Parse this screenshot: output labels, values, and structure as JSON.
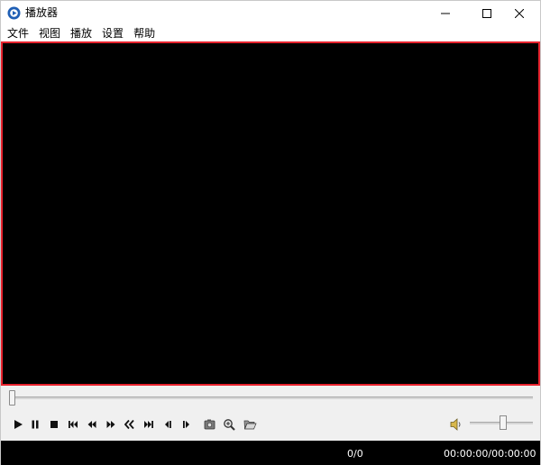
{
  "window": {
    "title": "播放器",
    "controls": {
      "minimize_icon": "minimize-icon",
      "maximize_icon": "maximize-icon",
      "close_icon": "close-icon"
    }
  },
  "menu": {
    "items": [
      {
        "label": "文件"
      },
      {
        "label": "视图"
      },
      {
        "label": "播放"
      },
      {
        "label": "设置"
      },
      {
        "label": "帮助"
      }
    ]
  },
  "colors": {
    "video_background": "#000000",
    "video_border": "#e8232e",
    "status_background": "#000000",
    "status_text": "#ffffff"
  },
  "seekbar": {
    "position": 0.0
  },
  "playback_buttons": [
    {
      "name": "play-icon"
    },
    {
      "name": "pause-icon"
    },
    {
      "name": "stop-icon"
    },
    {
      "name": "skip-to-start-icon"
    },
    {
      "name": "rewind-icon"
    },
    {
      "name": "fast-forward-icon"
    },
    {
      "name": "previous-icon"
    },
    {
      "name": "next-icon"
    },
    {
      "name": "step-back-icon"
    },
    {
      "name": "step-forward-icon"
    },
    {
      "name": "screenshot-icon"
    },
    {
      "name": "zoom-icon"
    },
    {
      "name": "open-folder-icon"
    }
  ],
  "volume": {
    "level": 0.5,
    "icon": "speaker-icon"
  },
  "status": {
    "count": "0/0",
    "time": "00:00:00/00:00:00"
  }
}
